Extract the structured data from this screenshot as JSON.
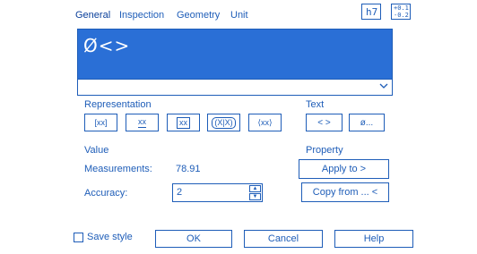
{
  "tabs": [
    "General",
    "Inspection",
    "Geometry",
    "Unit"
  ],
  "tolerance": {
    "fit_label": "h7",
    "upper": "+0.1",
    "lower": "-0.2"
  },
  "editor": {
    "text": "Ø<>"
  },
  "representation": {
    "title": "Representation",
    "buttons": [
      "[xx]",
      "xx",
      "xx",
      "(X|X)",
      "⟨xx⟩"
    ]
  },
  "text_section": {
    "title": "Text",
    "buttons": [
      "< >",
      "ø..."
    ]
  },
  "value": {
    "title": "Value",
    "measurements_label": "Measurements:",
    "measurements_value": "78.91",
    "accuracy_label": "Accuracy:",
    "accuracy_value": "2"
  },
  "property": {
    "title": "Property",
    "apply_label": "Apply to >",
    "copy_label": "Copy from ... <"
  },
  "footer": {
    "save_style": "Save style",
    "ok": "OK",
    "cancel": "Cancel",
    "help": "Help"
  },
  "colors": {
    "accent": "#1e5db8",
    "editor_bg": "#2a6fd6"
  }
}
